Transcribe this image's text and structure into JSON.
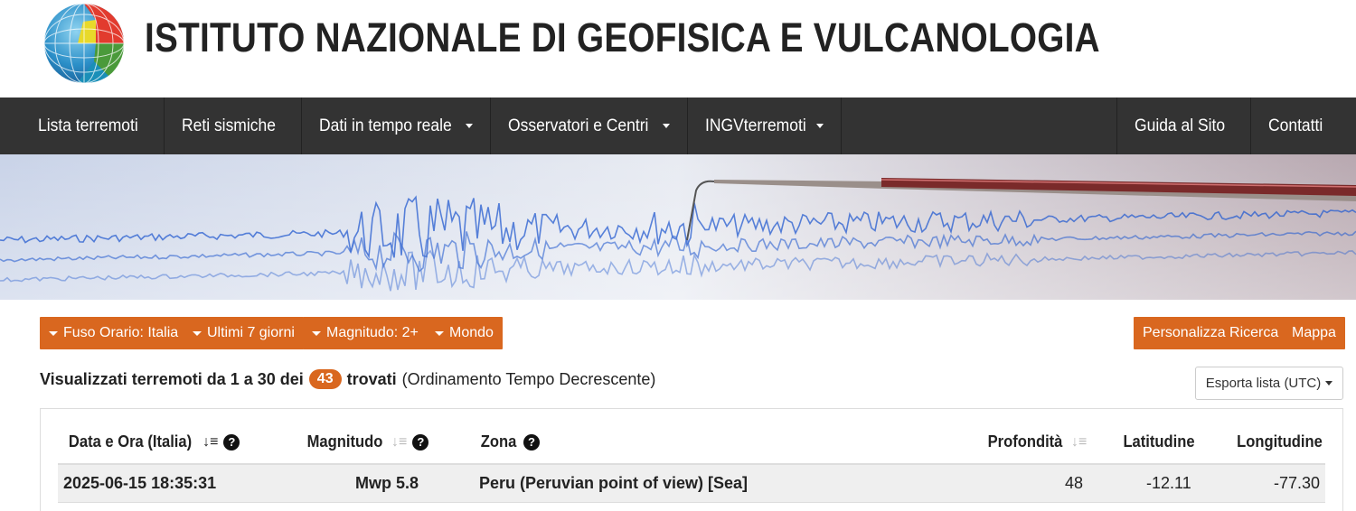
{
  "header": {
    "title": "ISTITUTO NAZIONALE DI GEOFISICA E VULCANOLOGIA",
    "logo_icon": "globe-logo-icon"
  },
  "nav": {
    "left": [
      {
        "label": "Lista terremoti",
        "dropdown": false
      },
      {
        "label": "Reti sismiche",
        "dropdown": false
      },
      {
        "label": "Dati in tempo reale",
        "dropdown": true
      },
      {
        "label": "Osservatori e Centri",
        "dropdown": true
      },
      {
        "label": "INGVterremoti",
        "dropdown": true
      }
    ],
    "right": [
      {
        "label": "Guida al Sito"
      },
      {
        "label": "Contatti"
      }
    ]
  },
  "filters": {
    "timezone": "Fuso Orario: Italia",
    "period": "Ultimi 7 giorni",
    "magnitude": "Magnitudo: 2+",
    "region": "Mondo",
    "customize": "Personalizza Ricerca",
    "map": "Mappa"
  },
  "summary": {
    "prefix": "Visualizzati terremoti da 1 a 30 dei",
    "count": "43",
    "found": "trovati",
    "order": "(Ordinamento Tempo Decrescente)"
  },
  "export": {
    "label": "Esporta lista (UTC)"
  },
  "table": {
    "columns": {
      "datetime": "Data e Ora (Italia)",
      "magnitude": "Magnitudo",
      "zone": "Zona",
      "depth": "Profondità",
      "latitude": "Latitudine",
      "longitude": "Longitudine"
    },
    "rows": [
      {
        "datetime": "2025-06-15 18:35:31",
        "magnitude": "Mwp 5.8",
        "zone": "Peru (Peruvian point of view) [Sea]",
        "depth": "48",
        "latitude": "-12.11",
        "longitude": "-77.30"
      }
    ]
  },
  "colors": {
    "accent": "#d9671f",
    "navbar": "#333333",
    "seismogram": "#2a5fd0"
  }
}
